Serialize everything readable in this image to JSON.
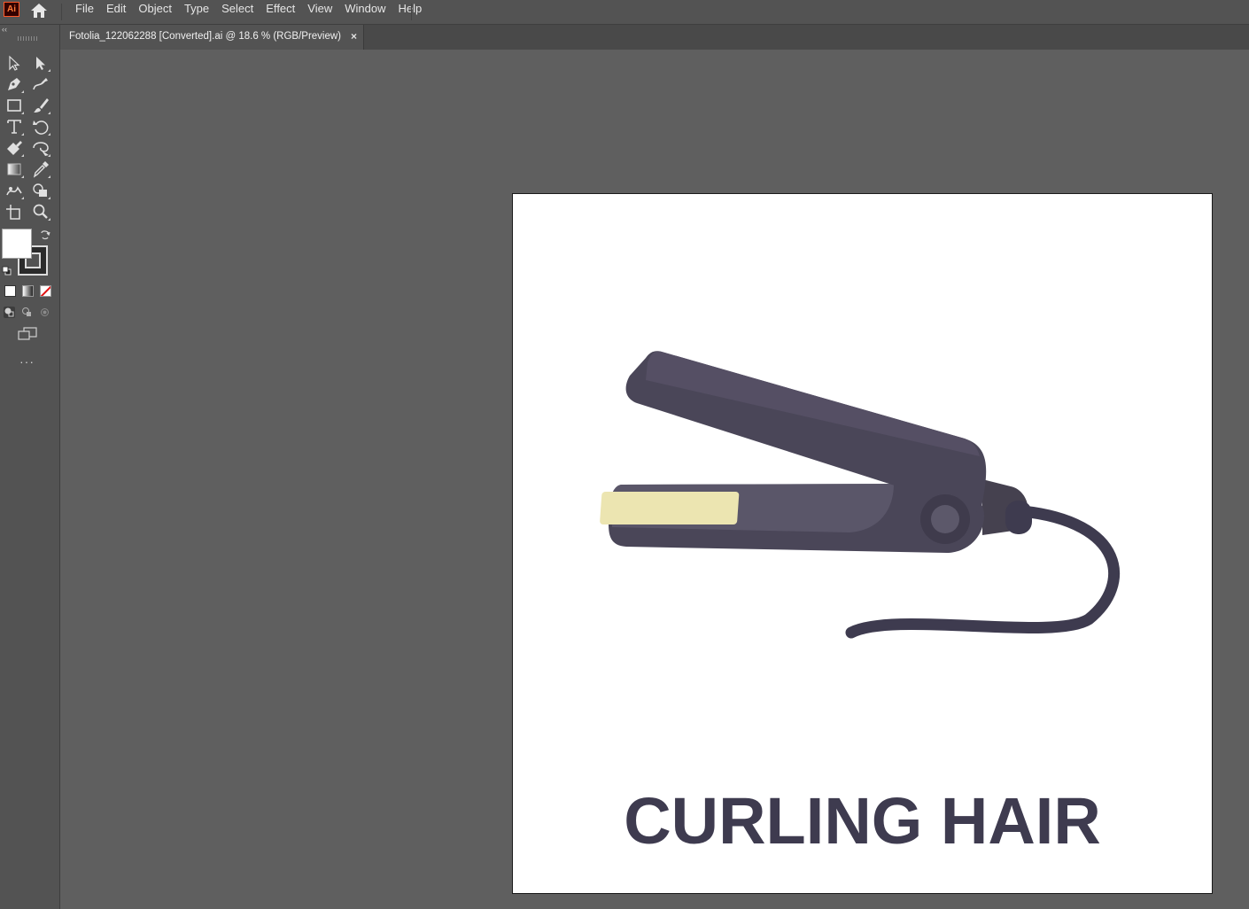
{
  "app": {
    "logo_text": "Ai",
    "menu": [
      "File",
      "Edit",
      "Object",
      "Type",
      "Select",
      "Effect",
      "View",
      "Window",
      "Help"
    ]
  },
  "document_tab": {
    "title": "Fotolia_122062288 [Converted].ai @ 18.6 % (RGB/Preview)",
    "close_glyph": "×"
  },
  "toolbar": {
    "collapse_glyph": "‹‹",
    "more_glyph": "···",
    "tools": [
      "selection-tool",
      "direct-selection-tool",
      "pen-tool",
      "curvature-tool",
      "rectangle-tool",
      "paintbrush-tool",
      "type-tool",
      "rotate-tool",
      "shaper-tool",
      "warp-tool",
      "gradient-tool",
      "eyedropper-tool",
      "puppet-warp-tool",
      "shape-builder-tool",
      "artboard-tool",
      "zoom-tool"
    ],
    "fill_color": "#ffffff",
    "stroke_color": "#2b2b2b"
  },
  "artboard": {
    "caption": "CURLING HAIR",
    "illustration": "hair-straightener",
    "colors": {
      "body": "#4a4658",
      "plate": "#ece5b1",
      "cord": "#3e3b4f",
      "caption": "#3e3b4f"
    }
  }
}
